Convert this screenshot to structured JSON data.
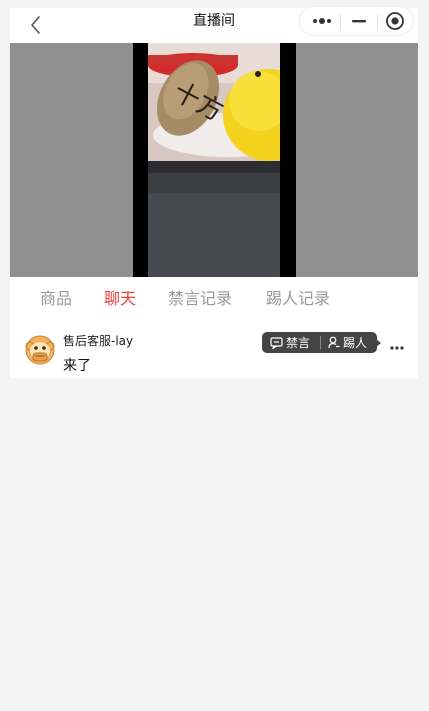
{
  "header": {
    "title": "直播间"
  },
  "tabs": [
    {
      "label": "商品"
    },
    {
      "label": "聊天"
    },
    {
      "label": "禁言记录"
    },
    {
      "label": "踢人记录"
    }
  ],
  "active_tab": "聊天",
  "chat": {
    "messages": [
      {
        "username": "售后客服-lay",
        "text": "来了",
        "actions": {
          "mute_label": "禁言",
          "kick_label": "踢人"
        }
      }
    ]
  },
  "colors": {
    "accent": "#e8403c",
    "page_bg": "#f4f4f4",
    "video_bg": "#909090"
  }
}
